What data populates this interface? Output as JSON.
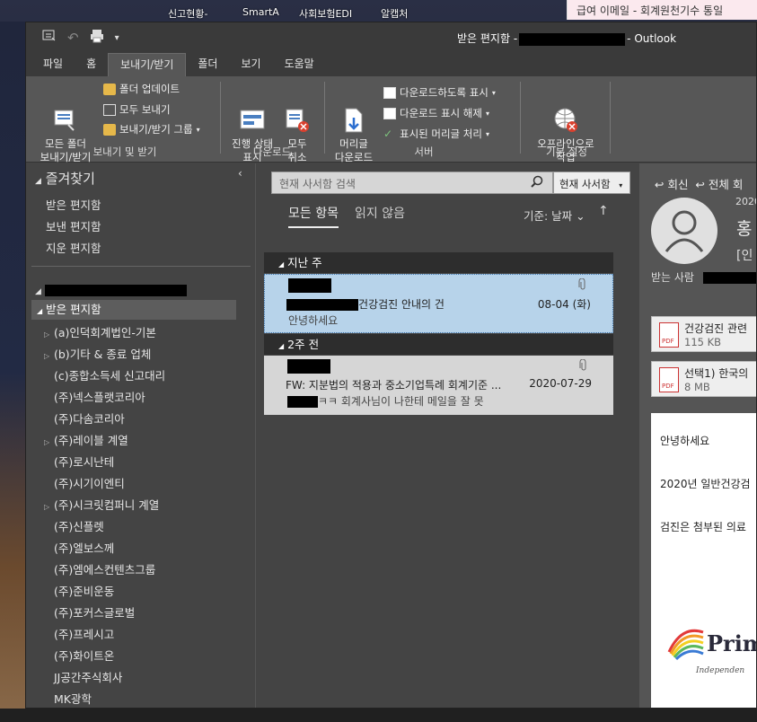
{
  "desktop": {
    "taskbar": [
      "신고현황-",
      "SmartA",
      "사회보험EDI",
      "알캡처"
    ],
    "notification": "급여 이메일 - 회계원천기수 통일"
  },
  "window": {
    "title_prefix": "받은 편지함 -",
    "title_suffix": "- Outlook"
  },
  "tabs": [
    "파일",
    "홈",
    "보내기/받기",
    "폴더",
    "보기",
    "도움말"
  ],
  "ribbon": {
    "groups": {
      "sendreceive": {
        "label": "보내기 및 받기",
        "all_folders": "모든 폴더\n보내기/받기",
        "update_folder": "폴더 업데이트",
        "send_all": "모두 보내기",
        "groups": "보내기/받기 그룹"
      },
      "download": {
        "label": "다운로드",
        "show_progress": "진행 상태\n표시",
        "cancel_all": "모두\n취소"
      },
      "server": {
        "label": "서버",
        "download_headers": "머리글\n다운로드",
        "mark_download": "다운로드하도록 표시",
        "unmark_download": "다운로드 표시 해제",
        "process_marked": "표시된 머리글 처리"
      },
      "preferences": {
        "label": "기본 설정",
        "work_offline": "오프라인으로\n작업"
      }
    }
  },
  "folders": {
    "favorites_header": "즐겨찾기",
    "favorites": [
      "받은 편지함",
      "보낸 편지함",
      "지운 편지함"
    ],
    "inbox": "받은 편지함",
    "subfolders": [
      {
        "name": "(a)인덕회계법인-기본",
        "expandable": true
      },
      {
        "name": "(b)기타 & 종료 업체",
        "expandable": true
      },
      {
        "name": "(c)종합소득세 신고대리",
        "expandable": false
      },
      {
        "name": "(주)넥스플랫코리아",
        "expandable": false
      },
      {
        "name": "(주)다솜코리아",
        "expandable": false
      },
      {
        "name": "(주)레이블 계열",
        "expandable": true
      },
      {
        "name": "(주)로시난테",
        "expandable": false
      },
      {
        "name": "(주)시기이엔티",
        "expandable": false
      },
      {
        "name": "(주)시크릿컴퍼니 계열",
        "expandable": true
      },
      {
        "name": "(주)신플렛",
        "expandable": false
      },
      {
        "name": "(주)엘보스께",
        "expandable": false
      },
      {
        "name": "(주)엠에스컨텐츠그룹",
        "expandable": false
      },
      {
        "name": "(주)준비운동",
        "expandable": false
      },
      {
        "name": "(주)포커스글로벌",
        "expandable": false
      },
      {
        "name": "(주)프레시고",
        "expandable": false
      },
      {
        "name": "(주)화이트온",
        "expandable": false
      },
      {
        "name": "JJ공간주식회사",
        "expandable": false
      },
      {
        "name": "MK광학",
        "expandable": false
      }
    ]
  },
  "list": {
    "search_placeholder": "현재 사서함 검색",
    "scope": "현재 사서함",
    "filter_all": "모든 항목",
    "filter_unread": "읽지 않음",
    "sort": "기준: 날짜",
    "groups": [
      {
        "label": "지난 주",
        "messages": [
          {
            "subject": "건강검진 안내의 건",
            "date": "08-04 (화)",
            "preview": "안녕하세요",
            "attachment": true,
            "selected": true
          }
        ]
      },
      {
        "label": "2주 전",
        "messages": [
          {
            "subject": "FW: 지분법의 적용과 중소기업특례 회계기준 ...",
            "date": "2020-07-29",
            "preview": "ㅋㅋ  회계사님이 나한테 메일을 잘 못",
            "attachment": true,
            "selected": false
          }
        ]
      }
    ]
  },
  "reading": {
    "reply": "회신",
    "reply_all": "전체 회",
    "year": "2020",
    "sender_initial": "홍",
    "subject_prefix": "[인",
    "to_label": "받는 사람",
    "attachments": [
      {
        "name": "건강검진 관련",
        "size": "115 KB"
      },
      {
        "name": "선택1) 한국의",
        "size": "8 MB"
      }
    ],
    "body_lines": [
      "안녕하세요",
      "2020년 일반건강검",
      "검진은 첨부된 의료"
    ],
    "logo_text": "Prim",
    "logo_tagline": "Independen"
  },
  "colors": {
    "ribbon_bg": "#575757",
    "window_bg": "#444444",
    "selected_msg": "#b7d3ea"
  }
}
